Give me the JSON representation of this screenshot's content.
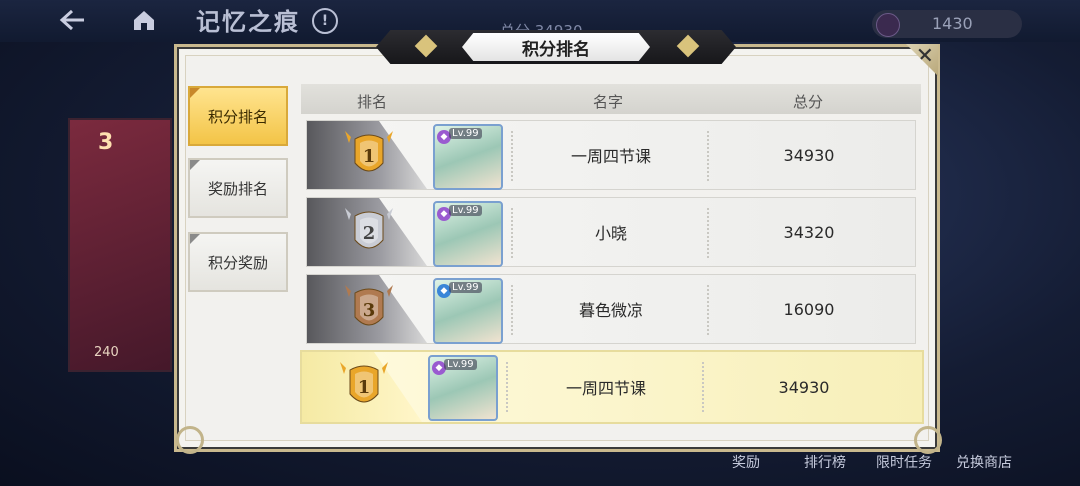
{
  "hud": {
    "title": "记忆之痕",
    "info": "!",
    "total_label": "总分 34930",
    "currency_amount": "1430",
    "side_card_number": "3",
    "side_card_cost": "240",
    "bottom_nav": [
      "奖励",
      "排行榜",
      "限时任务",
      "兑换商店"
    ]
  },
  "modal": {
    "title": "积分排名",
    "close": "✕",
    "tabs": [
      {
        "label": "积分排名",
        "active": true
      },
      {
        "label": "奖励排名",
        "active": false
      },
      {
        "label": "积分奖励",
        "active": false
      }
    ],
    "columns": {
      "rank": "排名",
      "name": "名字",
      "score": "总分"
    },
    "rows": [
      {
        "rank": "1",
        "level": "Lv.99",
        "name": "一周四节课",
        "score": "34930",
        "medal": "gold",
        "elem_color": "#9a5bd0"
      },
      {
        "rank": "2",
        "level": "Lv.99",
        "name": "小晓",
        "score": "34320",
        "medal": "silver",
        "elem_color": "#9a5bd0"
      },
      {
        "rank": "3",
        "level": "Lv.99",
        "name": "暮色微凉",
        "score": "16090",
        "medal": "bronze",
        "elem_color": "#3a86d8"
      }
    ],
    "self_row": {
      "rank": "1",
      "level": "Lv.99",
      "name": "一周四节课",
      "score": "34930",
      "medal": "gold",
      "elem_color": "#9a5bd0"
    }
  },
  "colors": {
    "gold": "#e9a62a",
    "silver": "#c9ccd4",
    "bronze": "#b07a50",
    "active_tab": "#f3c447"
  }
}
